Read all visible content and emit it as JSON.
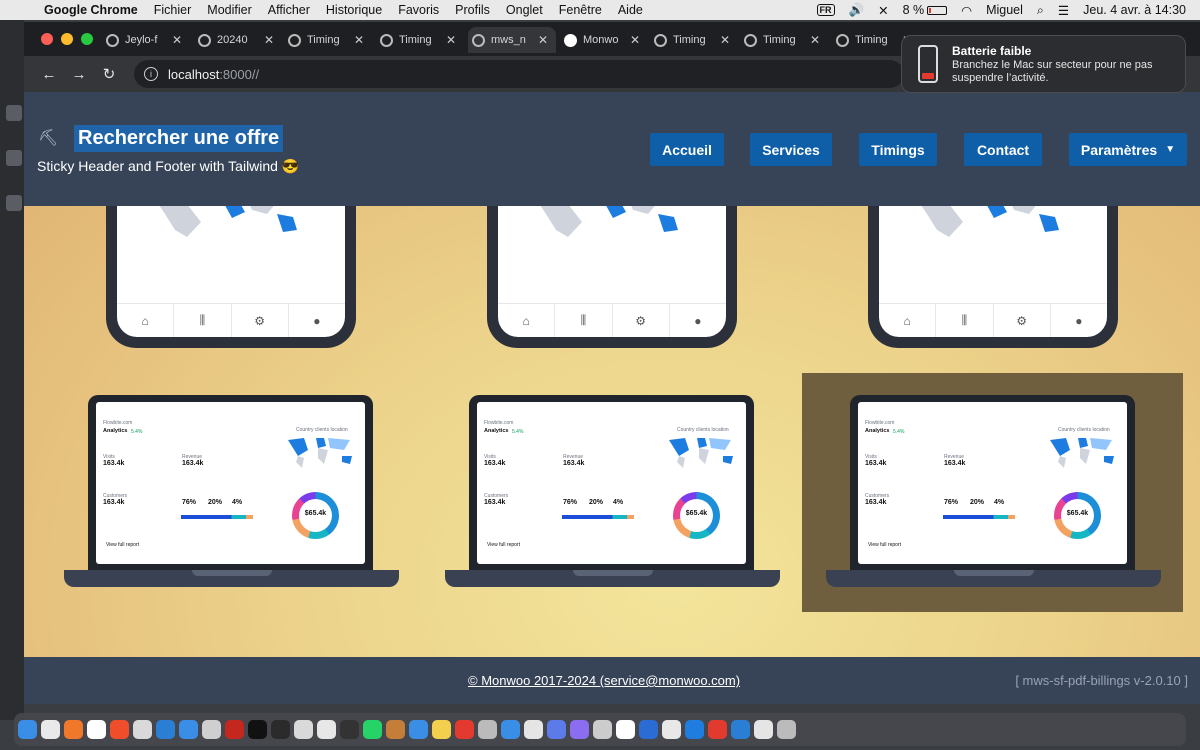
{
  "menubar": {
    "app_name": "Google Chrome",
    "menus": [
      "Fichier",
      "Modifier",
      "Afficher",
      "Historique",
      "Favoris",
      "Profils",
      "Onglet",
      "Fenêtre",
      "Aide"
    ],
    "input_source": "FR",
    "battery": "8 %",
    "user": "Miguel",
    "datetime": "Jeu. 4 avr. à 14:30"
  },
  "tabs": [
    {
      "label": "Jeylo-f"
    },
    {
      "label": "20240"
    },
    {
      "label": "Timing"
    },
    {
      "label": "Timing"
    },
    {
      "label": "mws_n"
    },
    {
      "label": "Monwo"
    },
    {
      "label": "Timing"
    },
    {
      "label": "Timing"
    },
    {
      "label": "Timing"
    }
  ],
  "address_bar": {
    "host": "localhost",
    "rest": ":8000//"
  },
  "notification": {
    "title": "Batterie faible",
    "body": "Branchez le Mac sur secteur pour ne pas suspendre l’activité."
  },
  "site": {
    "title": "Rechercher une offre",
    "subtitle": "Sticky Header and Footer with Tailwind 😎",
    "nav": [
      "Accueil",
      "Services",
      "Timings",
      "Contact",
      "Paramètres"
    ],
    "footer_copyright": "© Monwoo 2017-2024 (service@monwoo.com)",
    "footer_version": "[ mws-sf-pdf-billings v-2.0.10 ]"
  },
  "dashboard": {
    "brand": "Flowbite.com",
    "title": "Analytics",
    "badge": "5.4%",
    "visits_label": "Visits",
    "visits_value": "163.4k",
    "revenue_label": "Revenue",
    "revenue_value": "163.4k",
    "customers_label": "Customers",
    "customers_value": "163.4k",
    "desktop_pct": "76%",
    "mobile_pct": "20%",
    "tablet_pct": "4%",
    "donut_value": "$65.4k",
    "map_title": "Country clients location",
    "report_link": "View full report"
  },
  "colors": {
    "header_bg": "#374357",
    "nav_btn": "#0f5ea8",
    "accent": "#1f63a8"
  }
}
